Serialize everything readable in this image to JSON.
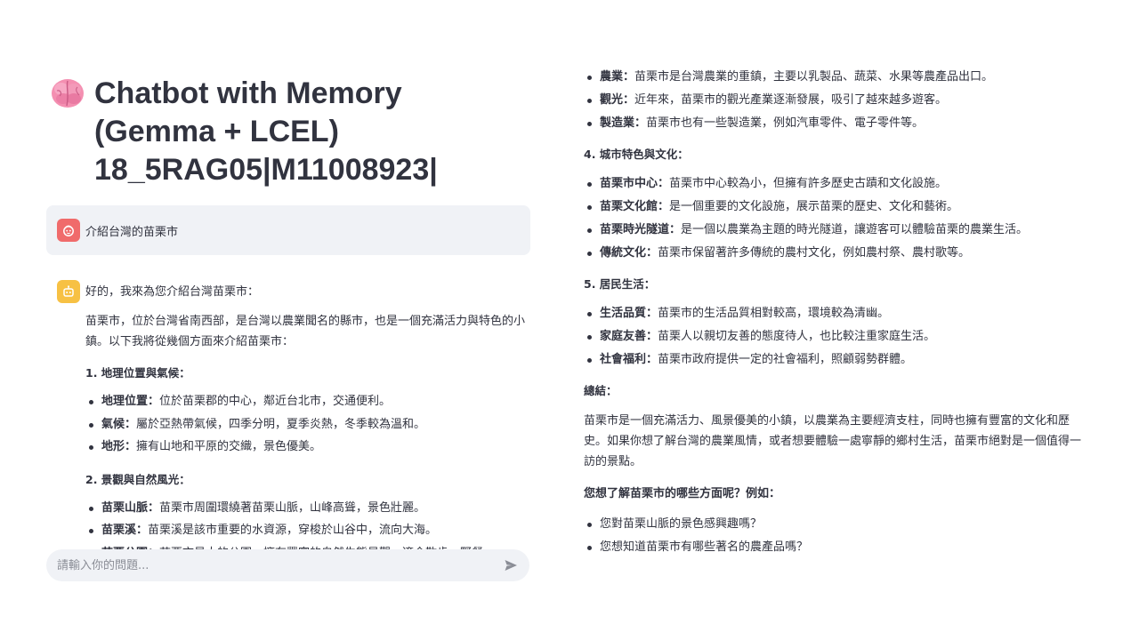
{
  "header": {
    "title": "Chatbot with Memory (Gemma + LCEL) 18_5RAG05|M11008923|"
  },
  "user_message": {
    "text": "介紹台灣的苗栗市"
  },
  "assistant_message": {
    "greeting": "好的，我來為您介紹台灣苗栗市：",
    "intro": "苗栗市，位於台灣省南西部，是台灣以農業聞名的縣市，也是一個充滿活力與特色的小鎮。以下我將從幾個方面來介紹苗栗市：",
    "sections": [
      {
        "heading": "1. 地理位置與氣候：",
        "items": [
          {
            "term": "地理位置：",
            "desc": "位於苗栗郡的中心，鄰近台北市，交通便利。"
          },
          {
            "term": "氣候：",
            "desc": "屬於亞熱帶氣候，四季分明，夏季炎熱，冬季較為溫和。"
          },
          {
            "term": "地形：",
            "desc": "擁有山地和平原的交織，景色優美。"
          }
        ]
      },
      {
        "heading": "2. 景觀與自然風光：",
        "items": [
          {
            "term": "苗栗山脈：",
            "desc": "苗栗市周圍環繞著苗栗山脈，山峰高聳，景色壯麗。"
          },
          {
            "term": "苗栗溪：",
            "desc": "苗栗溪是該市重要的水資源，穿梭於山谷中，流向大海。"
          },
          {
            "term": "苗栗公園：",
            "desc": "苗栗市最大的公園，擁有豐富的自然生態景觀，適合散步、野餐。"
          }
        ]
      }
    ],
    "continued": {
      "items_top": [
        {
          "term": "農業：",
          "desc": "苗栗市是台灣農業的重鎮，主要以乳製品、蔬菜、水果等農產品出口。"
        },
        {
          "term": "觀光：",
          "desc": "近年來，苗栗市的觀光產業逐漸發展，吸引了越來越多遊客。"
        },
        {
          "term": "製造業：",
          "desc": "苗栗市也有一些製造業，例如汽車零件、電子零件等。"
        }
      ],
      "section4": {
        "heading": "4. 城市特色與文化：",
        "items": [
          {
            "term": "苗栗市中心：",
            "desc": "苗栗市中心較為小，但擁有許多歷史古蹟和文化設施。"
          },
          {
            "term": "苗栗文化館：",
            "desc": "是一個重要的文化設施，展示苗栗的歷史、文化和藝術。"
          },
          {
            "term": "苗栗時光隧道：",
            "desc": "是一個以農業為主題的時光隧道，讓遊客可以體驗苗栗的農業生活。"
          },
          {
            "term": "傳統文化：",
            "desc": "苗栗市保留著許多傳統的農村文化，例如農村祭、農村歌等。"
          }
        ]
      },
      "section5": {
        "heading": "5. 居民生活：",
        "items": [
          {
            "term": "生活品質：",
            "desc": "苗栗市的生活品質相對較高，環境較為清幽。"
          },
          {
            "term": "家庭友善：",
            "desc": "苗栗人以親切友善的態度待人，也比較注重家庭生活。"
          },
          {
            "term": "社會福利：",
            "desc": "苗栗市政府提供一定的社會福利，照顧弱勢群體。"
          }
        ]
      },
      "summary_heading": "總結：",
      "summary": "苗栗市是一個充滿活力、風景優美的小鎮，以農業為主要經濟支柱，同時也擁有豐富的文化和歷史。如果你想了解台灣的農業風情，或者想要體驗一處寧靜的鄉村生活，苗栗市絕對是一個值得一訪的景點。",
      "ask": "您想了解苗栗市的哪些方面呢？例如：",
      "questions": [
        "您對苗栗山脈的景色感興趣嗎？",
        "您想知道苗栗市有哪些著名的農產品嗎？"
      ]
    }
  },
  "chat_input": {
    "placeholder": "請輸入你的問題..."
  },
  "icons": {
    "title_icon": "brain-icon",
    "user_avatar": "user-avatar-icon",
    "bot_avatar": "bot-avatar-icon",
    "send": "send-icon"
  },
  "colors": {
    "user_avatar": "#f06b6b",
    "bot_avatar": "#f7c144",
    "message_bg": "#f0f2f6"
  }
}
